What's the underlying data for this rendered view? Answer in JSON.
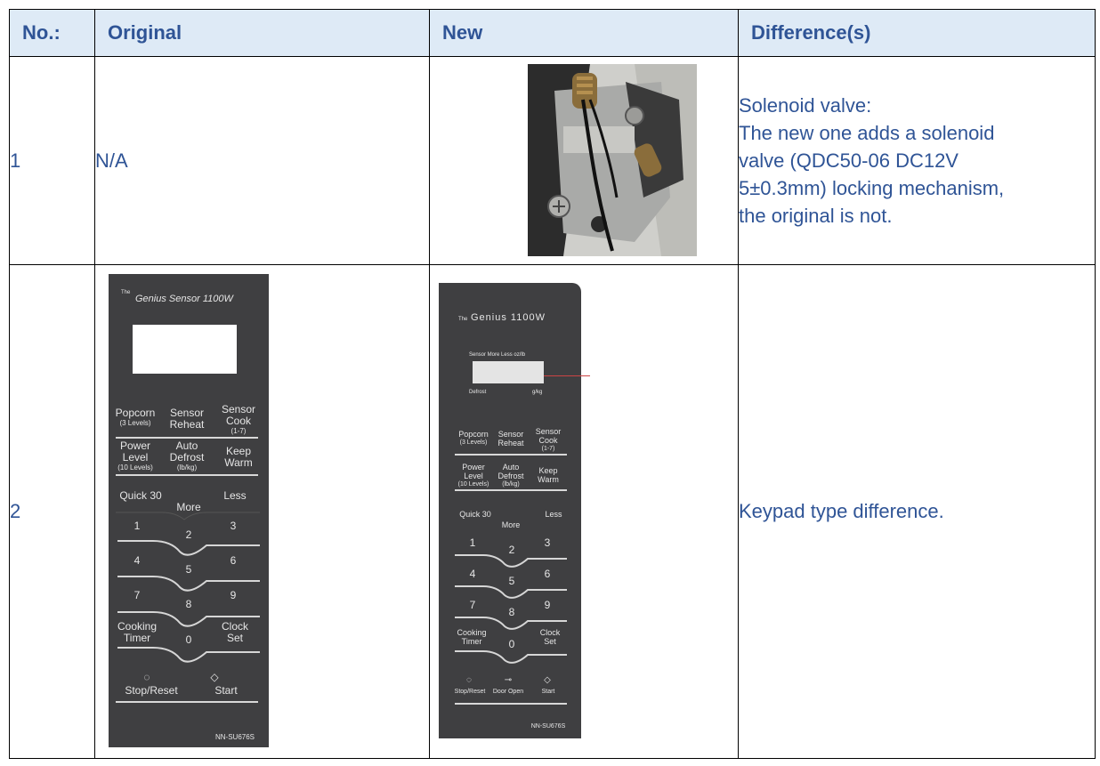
{
  "table": {
    "headers": [
      "No.:",
      "Original",
      "New",
      "Difference(s)"
    ],
    "rows": [
      {
        "no": "1",
        "original": "N/A",
        "new_image": "solenoid-valve-photo",
        "difference_lines": [
          "Solenoid valve:",
          "The new one adds a solenoid",
          "valve (QDC50-06 DC12V",
          "5±0.3mm) locking mechanism,",
          "the original is not."
        ]
      },
      {
        "no": "2",
        "original_image": "original-keypad",
        "new_image": "new-keypad",
        "difference": "Keypad type difference."
      }
    ]
  },
  "original_keypad": {
    "brand": "Genius Sensor 1100W",
    "brand_small": "The",
    "model": "NN-SU676S",
    "keys": {
      "popcorn": "Popcorn",
      "popcorn_sub": "(3 Levels)",
      "sensor_reheat_1": "Sensor",
      "sensor_reheat_2": "Reheat",
      "sensor_cook_1": "Sensor",
      "sensor_cook_2": "Cook",
      "sensor_cook_sub": "(1-7)",
      "power_1": "Power",
      "power_2": "Level",
      "power_sub": "(10 Levels)",
      "auto_1": "Auto",
      "auto_2": "Defrost",
      "auto_sub": "(lb/kg)",
      "keep_1": "Keep",
      "keep_2": "Warm",
      "quick30": "Quick 30",
      "more": "More",
      "less": "Less",
      "n1": "1",
      "n2": "2",
      "n3": "3",
      "n4": "4",
      "n5": "5",
      "n6": "6",
      "n7": "7",
      "n8": "8",
      "n9": "9",
      "n0": "0",
      "timer_1": "Cooking",
      "timer_2": "Timer",
      "clock_1": "Clock",
      "clock_2": "Set",
      "stop": "Stop/Reset",
      "start": "Start"
    }
  },
  "new_keypad": {
    "brand": "Genius 1100W",
    "brand_small": "The",
    "model": "NN-SU676S",
    "display_top": "Sensor  More   Less   oz/lb",
    "display_bottom_left": "Defrost",
    "display_bottom_right": "g/kg",
    "keys": {
      "popcorn": "Popcorn",
      "popcorn_sub": "(3 Levels)",
      "sensor_reheat_1": "Sensor",
      "sensor_reheat_2": "Reheat",
      "sensor_cook_1": "Sensor",
      "sensor_cook_2": "Cook",
      "sensor_cook_sub": "(1-7)",
      "power_1": "Power",
      "power_2": "Level",
      "power_sub": "(10 Levels)",
      "auto_1": "Auto",
      "auto_2": "Defrost",
      "auto_sub": "(lb/kg)",
      "keep_1": "Keep",
      "keep_2": "Warm",
      "quick30": "Quick 30",
      "more": "More",
      "less": "Less",
      "n1": "1",
      "n2": "2",
      "n3": "3",
      "n4": "4",
      "n5": "5",
      "n6": "6",
      "n7": "7",
      "n8": "8",
      "n9": "9",
      "n0": "0",
      "timer_1": "Cooking",
      "timer_2": "Timer",
      "clock_1": "Clock",
      "clock_2": "Set",
      "stop": "Stop/Reset",
      "door": "Door Open",
      "start": "Start"
    }
  }
}
